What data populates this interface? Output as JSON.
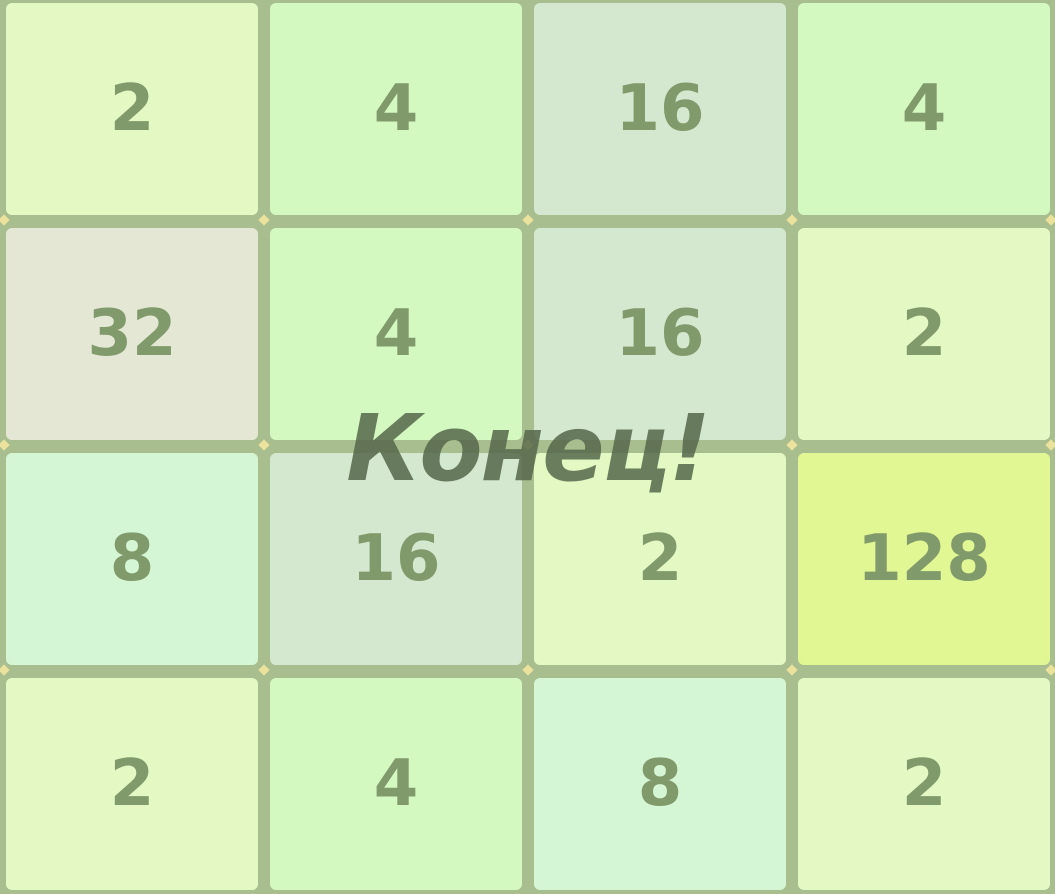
{
  "board": {
    "rows": [
      [
        "2",
        "4",
        "16",
        "4"
      ],
      [
        "32",
        "4",
        "16",
        "2"
      ],
      [
        "8",
        "16",
        "2",
        "128"
      ],
      [
        "2",
        "4",
        "8",
        "2"
      ]
    ]
  },
  "tile_colors": {
    "2": "#e3f8c3",
    "4": "#d3f8c0",
    "8": "#d5f6d4",
    "16": "#d4e7cf",
    "32": "#e3e7d4",
    "128": "#e0f793"
  },
  "text_color": "#819a6b",
  "board_color": "#a9be8f",
  "overlay": {
    "message": "Конец!"
  }
}
